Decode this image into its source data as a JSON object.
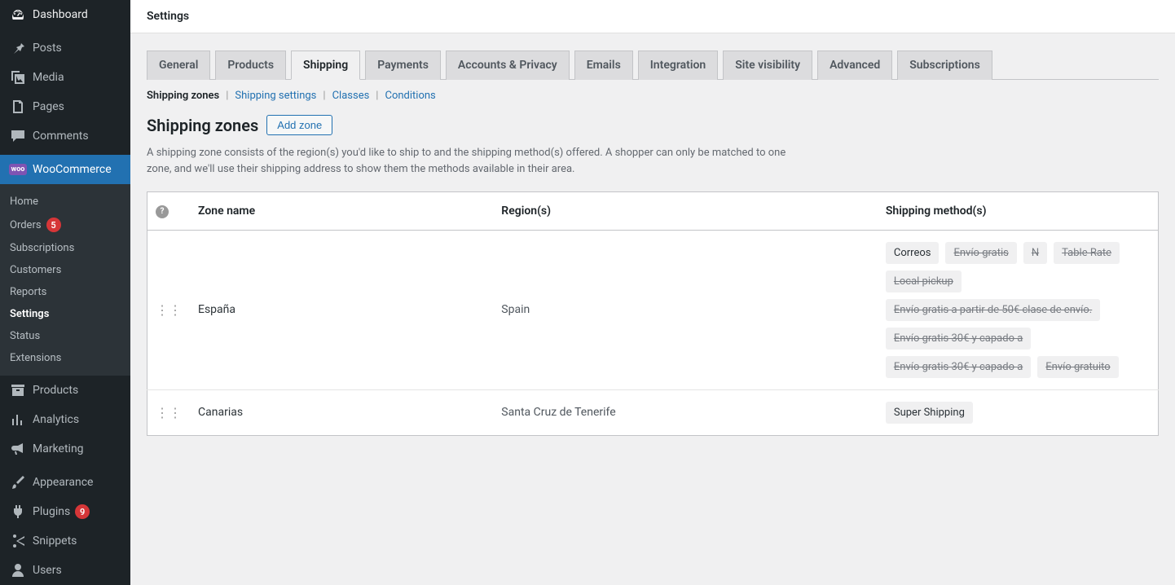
{
  "sidebar": {
    "primary": [
      {
        "label": "Dashboard",
        "icon": "dashboard"
      },
      {
        "label": "Posts",
        "icon": "pin"
      },
      {
        "label": "Media",
        "icon": "media"
      },
      {
        "label": "Pages",
        "icon": "page"
      },
      {
        "label": "Comments",
        "icon": "comment"
      }
    ],
    "woo": {
      "label": "WooCommerce"
    },
    "woo_sub": [
      {
        "label": "Home"
      },
      {
        "label": "Orders",
        "badge": "5"
      },
      {
        "label": "Subscriptions"
      },
      {
        "label": "Customers"
      },
      {
        "label": "Reports"
      },
      {
        "label": "Settings",
        "current": true
      },
      {
        "label": "Status"
      },
      {
        "label": "Extensions"
      }
    ],
    "secondary": [
      {
        "label": "Products",
        "icon": "archive"
      },
      {
        "label": "Analytics",
        "icon": "chart"
      },
      {
        "label": "Marketing",
        "icon": "megaphone"
      }
    ],
    "tertiary": [
      {
        "label": "Appearance",
        "icon": "brush"
      },
      {
        "label": "Plugins",
        "icon": "plugin",
        "badge": "9"
      },
      {
        "label": "Snippets",
        "icon": "scissors"
      },
      {
        "label": "Users",
        "icon": "user"
      }
    ]
  },
  "topbar": {
    "title": "Settings"
  },
  "tabs": [
    {
      "label": "General"
    },
    {
      "label": "Products"
    },
    {
      "label": "Shipping",
      "active": true
    },
    {
      "label": "Payments"
    },
    {
      "label": "Accounts & Privacy"
    },
    {
      "label": "Emails"
    },
    {
      "label": "Integration"
    },
    {
      "label": "Site visibility"
    },
    {
      "label": "Advanced"
    },
    {
      "label": "Subscriptions"
    }
  ],
  "subnav": [
    {
      "label": "Shipping zones",
      "current": true
    },
    {
      "label": "Shipping settings"
    },
    {
      "label": "Classes"
    },
    {
      "label": "Conditions"
    }
  ],
  "heading": "Shipping zones",
  "add_zone_label": "Add zone",
  "description": "A shipping zone consists of the region(s) you'd like to ship to and the shipping method(s) offered. A shopper can only be matched to one zone, and we'll use their shipping address to show them the methods available in their area.",
  "table": {
    "headers": {
      "name": "Zone name",
      "region": "Region(s)",
      "methods": "Shipping method(s)"
    },
    "rows": [
      {
        "name": "España",
        "region": "Spain",
        "methods": [
          {
            "label": "Correos",
            "disabled": false
          },
          {
            "label": "Envío gratis",
            "disabled": true
          },
          {
            "label": "N",
            "disabled": true
          },
          {
            "label": "Table Rate",
            "disabled": true
          },
          {
            "label": "Local pickup",
            "disabled": true
          },
          {
            "label": "Envío gratis a partir de 50€ clase de envío.",
            "disabled": true
          },
          {
            "label": "Envío gratis 30€ y capado a",
            "disabled": true
          },
          {
            "label": "Envío gratis 30€ y capado a",
            "disabled": true
          },
          {
            "label": "Envío gratuito",
            "disabled": true
          }
        ]
      },
      {
        "name": "Canarias",
        "region": "Santa Cruz de Tenerife",
        "methods": [
          {
            "label": "Super Shipping",
            "disabled": false
          }
        ]
      }
    ]
  }
}
